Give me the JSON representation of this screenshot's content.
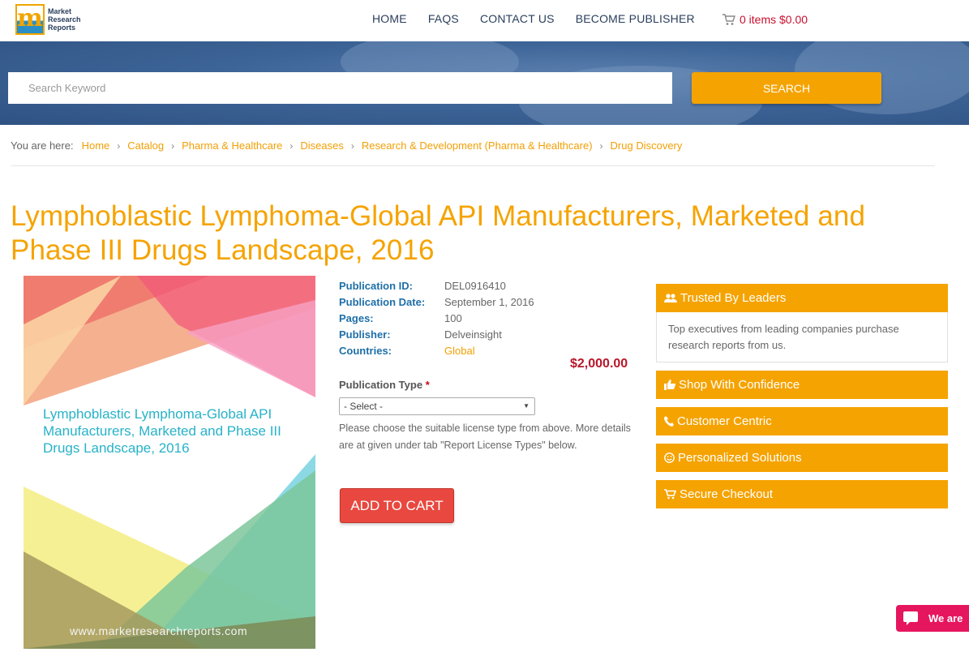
{
  "header": {
    "logo_line1": "Market",
    "logo_line2": "Research",
    "logo_line3": "Reports",
    "logo_glyph": "m",
    "nav": [
      "HOME",
      "FAQS",
      "CONTACT US",
      "BECOME PUBLISHER"
    ],
    "cart_text": "0 items $0.00"
  },
  "search": {
    "placeholder": "Search Keyword",
    "button_label": "SEARCH"
  },
  "breadcrumb": {
    "label": "You are here:",
    "items": [
      "Home",
      "Catalog",
      "Pharma & Healthcare",
      "Diseases",
      "Research & Development (Pharma & Healthcare)",
      "Drug Discovery"
    ]
  },
  "product": {
    "title": "Lymphoblastic Lymphoma-Global API Manufacturers, Marketed and Phase III Drugs Landscape, 2016",
    "cover_title": "Lymphoblastic Lymphoma-Global API Manufacturers, Marketed and Phase III Drugs Landscape, 2016",
    "cover_url": "www.marketresearchreports.com",
    "meta": [
      {
        "key": "Publication ID:",
        "value": "DEL0916410"
      },
      {
        "key": "Publication Date:",
        "value": "September 1, 2016"
      },
      {
        "key": "Pages:",
        "value": "100"
      },
      {
        "key": "Publisher:",
        "value": "Delveinsight"
      },
      {
        "key": "Countries:",
        "value": "Global"
      }
    ],
    "price": "$2,000.00",
    "publication_type_label": "Publication Type",
    "required_mark": "*",
    "select_value": "- Select -",
    "help_text": "Please choose the suitable license type from above. More details are at given under tab \"Report License Types\" below.",
    "add_to_cart": "ADD TO CART"
  },
  "sidebar": {
    "panels": [
      {
        "title": "Trusted By Leaders",
        "icon": "users-icon"
      },
      {
        "title": "Shop With Confidence",
        "icon": "thumbs-up-icon"
      },
      {
        "title": "Customer Centric",
        "icon": "phone-icon"
      },
      {
        "title": "Personalized Solutions",
        "icon": "smile-icon"
      },
      {
        "title": "Secure Checkout",
        "icon": "cart-icon"
      }
    ],
    "trusted_body": "Top executives from leading companies purchase research reports from us."
  },
  "chat": {
    "label": "We are"
  },
  "colors": {
    "accent": "#f5a300",
    "link": "#f29f05",
    "price": "#b8162a",
    "button": "#e8483f",
    "meta_key": "#1e6fa8"
  }
}
